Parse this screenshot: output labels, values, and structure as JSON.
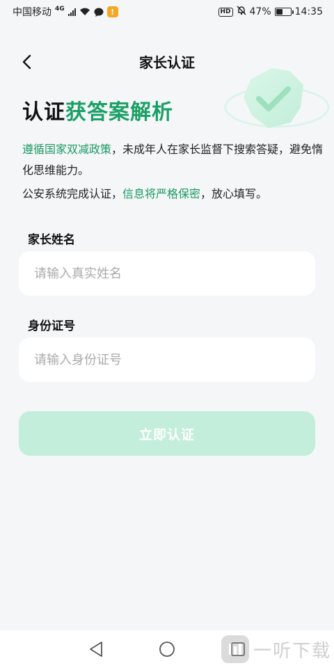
{
  "status_bar": {
    "carrier": "中国移动",
    "network": "4G",
    "notification_badge": "!",
    "hd": "HD",
    "battery": "47%",
    "battery_level": 0.47,
    "time": "14:35"
  },
  "header": {
    "title": "家长认证",
    "back_icon": "chevron-left-icon"
  },
  "heading": {
    "part1": "认证",
    "part2": "获答案解析"
  },
  "description": {
    "line1_highlight": "遵循国家双减政策",
    "line1_rest": "，未成年人在家长监督下搜索答疑，避免惰化思维能力。",
    "line2_start": "公安系统完成认证，",
    "line2_highlight": "信息将严格保密",
    "line2_end": "，放心填写。"
  },
  "form": {
    "name_label": "家长姓名",
    "name_placeholder": "请输入真实姓名",
    "name_value": "",
    "id_label": "身份证号",
    "id_placeholder": "请输入身份证号",
    "id_value": "",
    "submit_label": "立即认证"
  },
  "nav": {
    "back_icon": "triangle-back-icon",
    "home_icon": "circle-home-icon",
    "recent_icon": "square-recent-icon"
  },
  "watermark": {
    "logo": "一听",
    "text": "一听下载"
  },
  "colors": {
    "accent_green": "#1aa066",
    "button_disabled": "#c3eedb",
    "background": "#f5f6f8"
  }
}
